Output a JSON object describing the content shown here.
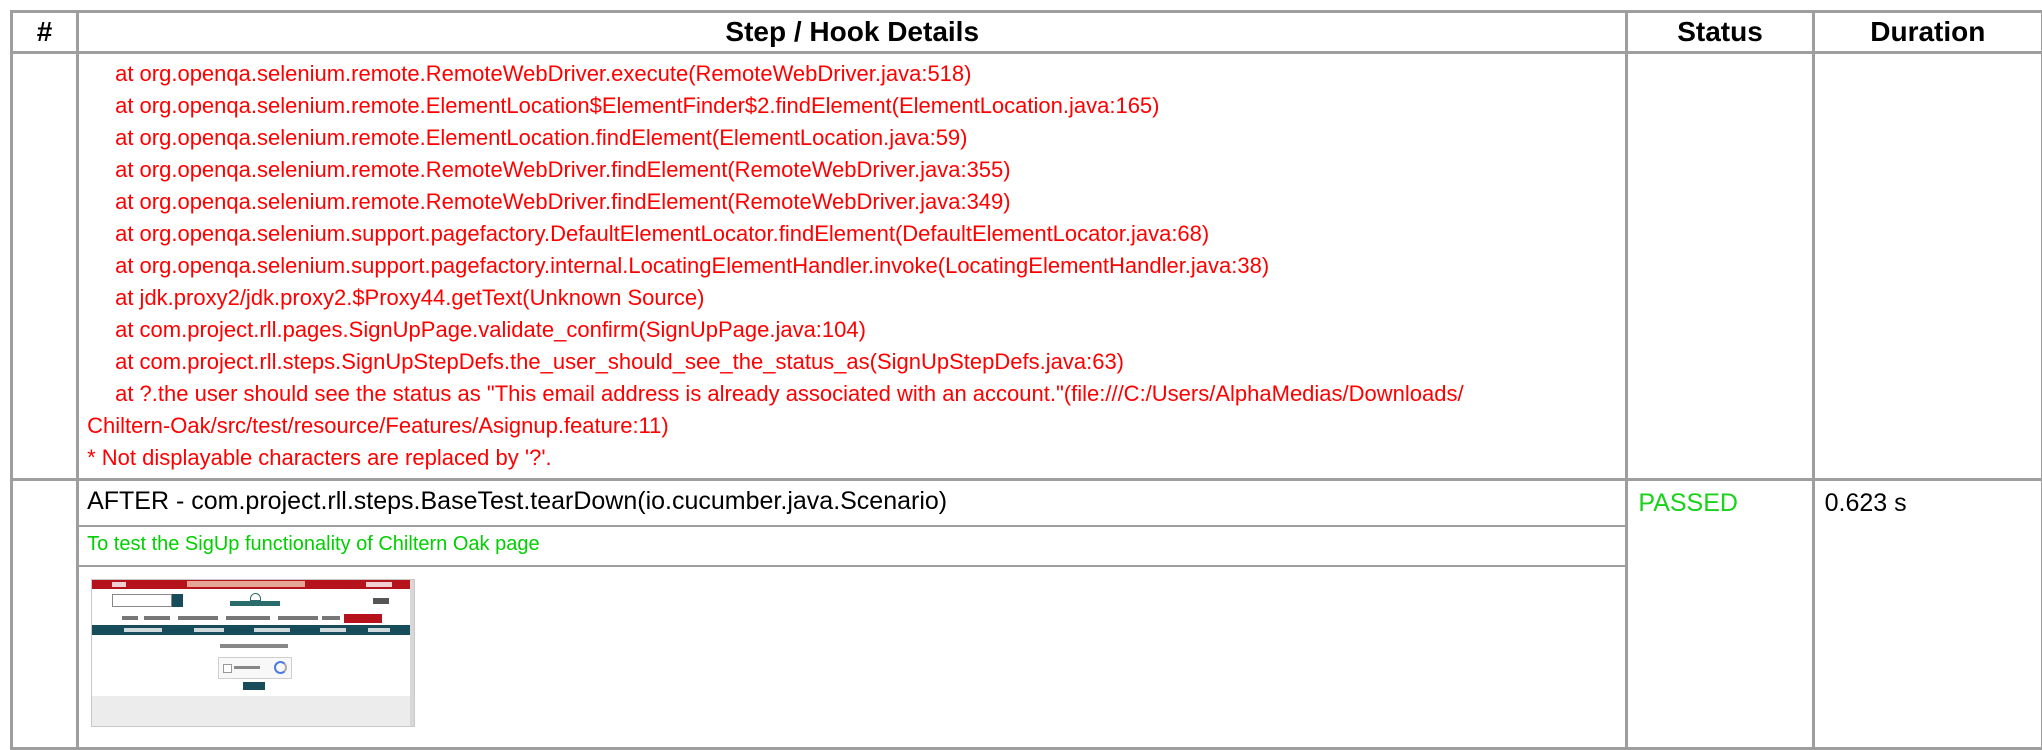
{
  "table": {
    "headers": {
      "num": "#",
      "details": "Step / Hook Details",
      "status": "Status",
      "duration": "Duration"
    }
  },
  "trace_lines": [
    "at org.openqa.selenium.remote.RemoteWebDriver.execute(RemoteWebDriver.java:518)",
    "at org.openqa.selenium.remote.ElementLocation$ElementFinder$2.findElement(ElementLocation.java:165)",
    "at org.openqa.selenium.remote.ElementLocation.findElement(ElementLocation.java:59)",
    "at org.openqa.selenium.remote.RemoteWebDriver.findElement(RemoteWebDriver.java:355)",
    "at org.openqa.selenium.remote.RemoteWebDriver.findElement(RemoteWebDriver.java:349)",
    "at org.openqa.selenium.support.pagefactory.DefaultElementLocator.findElement(DefaultElementLocator.java:68)",
    "at org.openqa.selenium.support.pagefactory.internal.LocatingElementHandler.invoke(LocatingElementHandler.java:38)",
    "at jdk.proxy2/jdk.proxy2.$Proxy44.getText(Unknown Source)",
    "at com.project.rll.pages.SignUpPage.validate_confirm(SignUpPage.java:104)",
    "at com.project.rll.steps.SignUpStepDefs.the_user_should_see_the_status_as(SignUpStepDefs.java:63)",
    "at ?.the user should see the status as \"This email address is already associated with an account.\"(file:///C:/Users/AlphaMedias/Downloads/",
    "Chiltern-Oak/src/test/resource/Features/Asignup.feature:11)",
    "* Not displayable characters are replaced by '?'."
  ],
  "hook": {
    "title": "AFTER - com.project.rll.steps.BaseTest.tearDown(io.cucumber.java.Scenario)",
    "description": "To test the SigUp functionality of Chiltern Oak page",
    "status": "PASSED",
    "duration": "0.623 s",
    "status_color": "#19d219"
  },
  "colors": {
    "error_text": "#ff0000",
    "description_text": "#00d000",
    "border": "#9e9e9e"
  }
}
